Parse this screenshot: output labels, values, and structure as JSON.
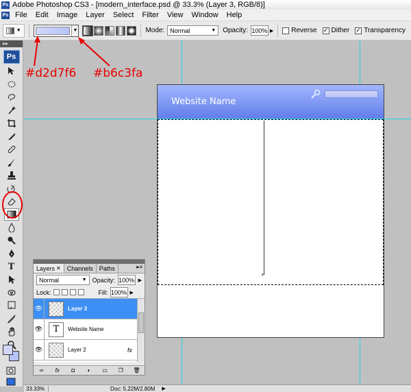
{
  "window": {
    "title": "Adobe Photoshop CS3 - [modern_interface.psd @ 33.3% (Layer 3, RGB/8)]"
  },
  "menu": [
    "File",
    "Edit",
    "Image",
    "Layer",
    "Select",
    "Filter",
    "View",
    "Window",
    "Help"
  ],
  "options": {
    "mode_label": "Mode:",
    "mode_value": "Normal",
    "opacity_label": "Opacity:",
    "opacity_value": "100%",
    "reverse_label": "Reverse",
    "dither_label": "Dither",
    "transparency_label": "Transparency",
    "gradient_start": "#d2d7f6",
    "gradient_end": "#b6c3fa"
  },
  "annotations": {
    "color_1": "#d2d7f6",
    "color_2": "#b6c3fa"
  },
  "toolbox": {
    "logo": "Ps"
  },
  "document": {
    "site_title": "Website Name"
  },
  "layers_panel": {
    "tabs": [
      "Layers",
      "Channels",
      "Paths"
    ],
    "blend_mode": "Normal",
    "opacity_label": "Opacity:",
    "opacity_value": "100%",
    "lock_label": "Lock:",
    "fill_label": "Fill:",
    "fill_value": "100%",
    "layers": [
      {
        "name": "Layer 3",
        "selected": true,
        "type": "pixel"
      },
      {
        "name": "Website Name",
        "selected": false,
        "type": "text"
      },
      {
        "name": "Layer 2",
        "selected": false,
        "type": "pixel",
        "fx": "fx"
      }
    ]
  },
  "status": {
    "zoom": "33.33%",
    "doc": "Doc: 5.22M/2.80M"
  }
}
